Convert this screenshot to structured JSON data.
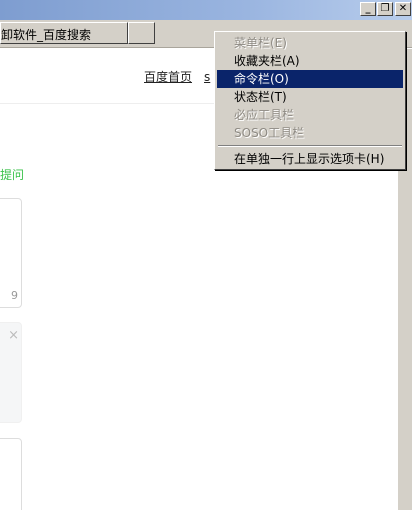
{
  "window": {
    "tab_title": "卸软件_百度搜索",
    "minimize_glyph": "_",
    "maximize_glyph": "❐",
    "close_glyph": "✕"
  },
  "page": {
    "link_home": "百度首页",
    "link_s": "s",
    "green_text": "提问",
    "card1_number": "9",
    "card2_close": "×"
  },
  "context_menu": {
    "items": [
      {
        "label": "菜单栏(E)",
        "state": "disabled"
      },
      {
        "label": "收藏夹栏(A)",
        "state": "normal"
      },
      {
        "label": "命令栏(O)",
        "state": "selected"
      },
      {
        "label": "状态栏(T)",
        "state": "normal"
      },
      {
        "label": "必应工具栏",
        "state": "disabled"
      },
      {
        "label": "SOSO工具栏",
        "state": "disabled"
      },
      {
        "label": "在单独一行上显示选项卡(H)",
        "state": "normal"
      }
    ]
  },
  "colors": {
    "selection": "#0a246a",
    "menu_bg": "#d4d0c8",
    "green_link": "#3ac24a"
  }
}
